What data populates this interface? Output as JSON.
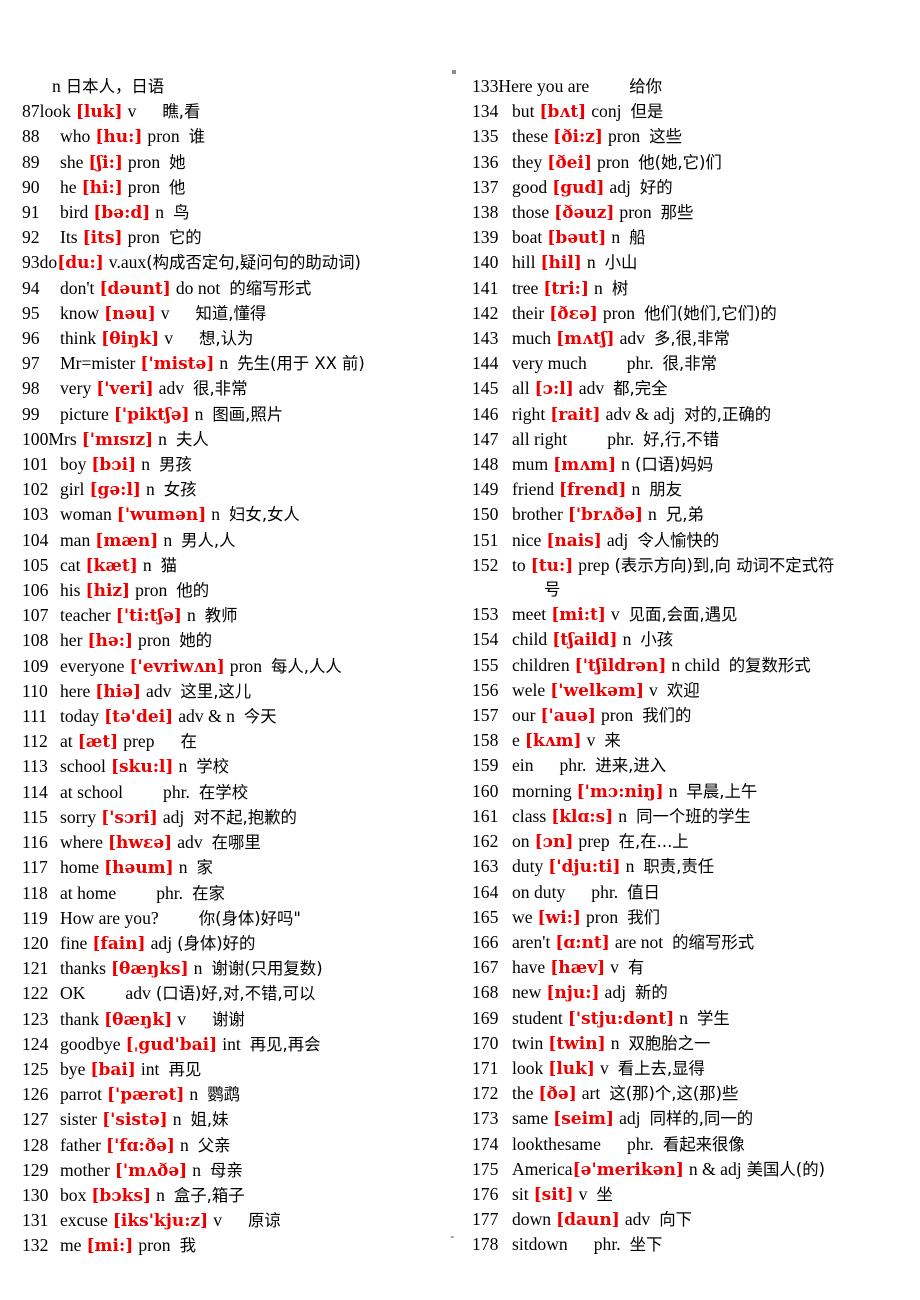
{
  "page": {
    "top_mark": "·",
    "bottom_mark": "-"
  },
  "header_line": {
    "pos": "n",
    "cn": "日本人，日语"
  },
  "left_column": [
    {
      "num": "87",
      "word": "look",
      "ipa": "[luk]",
      "pos": "v",
      "cn": "瞧,看",
      "gap": "sp4",
      "tight": true
    },
    {
      "num": "88",
      "word": "who",
      "ipa": "[hu:]",
      "pos": "pron",
      "cn": "谁",
      "gap": "sp2"
    },
    {
      "num": "89",
      "word": "she",
      "ipa": "[ʃi:]",
      "pos": "pron",
      "cn": "她",
      "gap": "sp2"
    },
    {
      "num": "90",
      "word": "he",
      "ipa": "[hi:]",
      "pos": "pron",
      "cn": "他",
      "gap": "sp2"
    },
    {
      "num": "91",
      "word": "bird",
      "ipa": "[bə:d]",
      "pos": "n",
      "cn": "鸟",
      "gap": "sp2"
    },
    {
      "num": "92",
      "word": "Its",
      "ipa": "[its]",
      "pos": "pron",
      "cn": "它的",
      "gap": "sp2"
    },
    {
      "num": "93",
      "word": "do",
      "ipa": "[du:]",
      "pos": "v.aux",
      "cn": "(构成否定句,疑问句的助动词)",
      "gap": "none",
      "tight": true,
      "nospace": true
    },
    {
      "num": "94",
      "word": "don't",
      "ipa": "[dəunt]",
      "pos": "do not",
      "cn": "的缩写形式",
      "gap": "sp2"
    },
    {
      "num": "95",
      "word": "know",
      "ipa": "[nəu]",
      "pos": "v",
      "cn": "知道,懂得",
      "gap": "sp4"
    },
    {
      "num": "96",
      "word": "think",
      "ipa": "[θiŋk]",
      "pos": "v",
      "cn": "想,认为",
      "gap": "sp4"
    },
    {
      "num": "97",
      "word": "Mr=mister",
      "ipa": "['mistə]",
      "pos": "n",
      "cn": "先生(用于 XX 前)",
      "gap": "sp2"
    },
    {
      "num": "98",
      "word": "very",
      "ipa": "['veri]",
      "pos": "adv",
      "cn": "很,非常",
      "gap": "sp2"
    },
    {
      "num": "99",
      "word": "picture",
      "ipa": "['piktʃə]",
      "pos": "n",
      "cn": "图画,照片",
      "gap": "sp2"
    },
    {
      "num": "100",
      "word": "Mrs",
      "ipa": "['mɪsɪz]",
      "pos": "n",
      "cn": "夫人",
      "gap": "sp2",
      "tight": true
    },
    {
      "num": "101",
      "word": "boy",
      "ipa": "[bɔi]",
      "pos": "n",
      "cn": "男孩",
      "gap": "sp2"
    },
    {
      "num": "102",
      "word": "girl",
      "ipa": "[gə:l]",
      "pos": "n",
      "cn": "女孩",
      "gap": "sp2"
    },
    {
      "num": "103",
      "word": "woman",
      "ipa": "['wumən]",
      "pos": "n",
      "cn": "妇女,女人",
      "gap": "sp2"
    },
    {
      "num": "104",
      "word": "man",
      "ipa": "[mæn]",
      "pos": "n",
      "cn": "男人,人",
      "gap": "sp2"
    },
    {
      "num": "105",
      "word": "cat",
      "ipa": "[kæt]",
      "pos": "n",
      "cn": "猫",
      "gap": "sp2"
    },
    {
      "num": "106",
      "word": "his",
      "ipa": "[hiz]",
      "pos": "pron",
      "cn": "他的",
      "gap": "sp2"
    },
    {
      "num": "107",
      "word": "teacher",
      "ipa": "['ti:tʃə]",
      "pos": "n",
      "cn": "教师",
      "gap": "sp2"
    },
    {
      "num": "108",
      "word": "her",
      "ipa": "[hə:]",
      "pos": "pron",
      "cn": "她的",
      "gap": "sp2"
    },
    {
      "num": "109",
      "word": "everyone",
      "ipa": "['evriwʌn]",
      "pos": "pron",
      "cn": "每人,人人",
      "gap": "sp2"
    },
    {
      "num": "110",
      "word": "here",
      "ipa": "[hiə]",
      "pos": "adv",
      "cn": "这里,这儿",
      "gap": "sp2"
    },
    {
      "num": "111",
      "word": "today",
      "ipa": "[tə'dei]",
      "pos": "adv & n",
      "cn": "今天",
      "gap": "sp2"
    },
    {
      "num": "112",
      "word": "at",
      "ipa": "[æt]",
      "pos": "prep",
      "cn": "在",
      "gap": "sp4"
    },
    {
      "num": "113",
      "word": "school",
      "ipa": "[sku:l]",
      "pos": "n",
      "cn": "学校",
      "gap": "sp2"
    },
    {
      "num": "114",
      "word": "at school",
      "ipa": "",
      "pos": "phr.",
      "cn": "在学校",
      "gap": "sp2",
      "posgap": "sp5"
    },
    {
      "num": "115",
      "word": "sorry",
      "ipa": "['sɔri]",
      "pos": "adj",
      "cn": "对不起,抱歉的",
      "gap": "sp2"
    },
    {
      "num": "116",
      "word": "where",
      "ipa": "[hwɛə]",
      "pos": "adv",
      "cn": "在哪里",
      "gap": "sp2"
    },
    {
      "num": "117",
      "word": "home",
      "ipa": "[həum]",
      "pos": "n",
      "cn": "家",
      "gap": "sp2"
    },
    {
      "num": "118",
      "word": "at home",
      "ipa": "",
      "pos": "phr.",
      "cn": "在家",
      "gap": "sp2",
      "posgap": "sp5"
    },
    {
      "num": "119",
      "word": "How are you?",
      "ipa": "",
      "pos": "",
      "cn": "你(身体)好吗\"",
      "gap": "sp5",
      "posgap": "sp5"
    },
    {
      "num": "120",
      "word": "fine",
      "ipa": "[fain]",
      "pos": "adj",
      "cn": "(身体)好的",
      "gap": "sp1"
    },
    {
      "num": "121",
      "word": "thanks",
      "ipa": "[θæŋks]",
      "pos": "n",
      "cn": "谢谢(只用复数)",
      "gap": "sp2"
    },
    {
      "num": "122",
      "word": "OK",
      "ipa": "",
      "pos": "adv",
      "cn": "(口语)好,对,不错,可以",
      "gap": "sp1",
      "posgap": "sp5"
    },
    {
      "num": "123",
      "word": "thank",
      "ipa": "[θæŋk]",
      "pos": "v",
      "cn": "谢谢",
      "gap": "sp4"
    },
    {
      "num": "124",
      "word": "goodbye",
      "ipa": "[ˌgud'bai]",
      "pos": "int",
      "cn": "再见,再会",
      "gap": "sp2"
    },
    {
      "num": "125",
      "word": "bye",
      "ipa": "[bai]",
      "pos": "int",
      "cn": "再见",
      "gap": "sp2"
    },
    {
      "num": "126",
      "word": "parrot",
      "ipa": "['pærət]",
      "pos": "n",
      "cn": "鹦鹉",
      "gap": "sp2"
    },
    {
      "num": "127",
      "word": "sister",
      "ipa": "['sistə]",
      "pos": "n",
      "cn": "姐,妹",
      "gap": "sp2"
    },
    {
      "num": "128",
      "word": "father",
      "ipa": "['fɑ:ðə]",
      "pos": "n",
      "cn": "父亲",
      "gap": "sp2"
    },
    {
      "num": "129",
      "word": "mother",
      "ipa": "['mʌðə]",
      "pos": "n",
      "cn": "母亲",
      "gap": "sp2"
    },
    {
      "num": "130",
      "word": "box",
      "ipa": "[bɔks]",
      "pos": "n",
      "cn": "盒子,箱子",
      "gap": "sp2"
    },
    {
      "num": "131",
      "word": "excuse",
      "ipa": "[iks'kju:z]",
      "pos": "v",
      "cn": "原谅",
      "gap": "sp4"
    },
    {
      "num": "132",
      "word": "me",
      "ipa": "[mi:]",
      "pos": "pron",
      "cn": "我",
      "gap": "sp2"
    }
  ],
  "right_column": [
    {
      "num": "133",
      "word": "Here you are",
      "ipa": "",
      "pos": "",
      "cn": "给你",
      "gap": "sp5",
      "tight": true
    },
    {
      "num": "134",
      "word": "but",
      "ipa": "[bʌt]",
      "pos": "conj",
      "cn": "但是",
      "gap": "sp2"
    },
    {
      "num": "135",
      "word": "these",
      "ipa": "[ði:z]",
      "pos": "pron",
      "cn": "这些",
      "gap": "sp2"
    },
    {
      "num": "136",
      "word": "they",
      "ipa": "[ðei]",
      "pos": "pron",
      "cn": "他(她,它)们",
      "gap": "sp2"
    },
    {
      "num": "137",
      "word": "good",
      "ipa": "[gud]",
      "pos": "adj",
      "cn": "好的",
      "gap": "sp2"
    },
    {
      "num": "138",
      "word": "those",
      "ipa": "[ðəuz]",
      "pos": "pron",
      "cn": "那些",
      "gap": "sp2"
    },
    {
      "num": "139",
      "word": "boat",
      "ipa": "[bəut]",
      "pos": "n",
      "cn": "船",
      "gap": "sp2"
    },
    {
      "num": "140",
      "word": "hill",
      "ipa": "[hil]",
      "pos": "n",
      "cn": "小山",
      "gap": "sp2"
    },
    {
      "num": "141",
      "word": "tree",
      "ipa": "[tri:]",
      "pos": "n",
      "cn": "树",
      "gap": "sp2"
    },
    {
      "num": "142",
      "word": "their",
      "ipa": "[ðɛə]",
      "pos": "pron",
      "cn": "他们(她们,它们)的",
      "gap": "sp2"
    },
    {
      "num": "143",
      "word": "much",
      "ipa": "[mʌtʃ]",
      "pos": "adv",
      "cn": "多,很,非常",
      "gap": "sp2"
    },
    {
      "num": "144",
      "word": "very much",
      "ipa": "",
      "pos": "phr.",
      "cn": "很,非常",
      "gap": "sp2",
      "posgap": "sp5"
    },
    {
      "num": "145",
      "word": "all",
      "ipa": "[ɔ:l]",
      "pos": "adv",
      "cn": "都,完全",
      "gap": "sp2"
    },
    {
      "num": "146",
      "word": "right",
      "ipa": "[rait]",
      "pos": "adv & adj",
      "cn": "对的,正确的",
      "gap": "sp2"
    },
    {
      "num": "147",
      "word": "all right",
      "ipa": "",
      "pos": "phr.",
      "cn": "好,行,不错",
      "gap": "sp2",
      "posgap": "sp5"
    },
    {
      "num": "148",
      "word": "mum",
      "ipa": "[mʌm]",
      "pos": "n",
      "cn": "(口语)妈妈",
      "gap": "sp1"
    },
    {
      "num": "149",
      "word": "friend",
      "ipa": "[frend]",
      "pos": "n",
      "cn": "朋友",
      "gap": "sp2"
    },
    {
      "num": "150",
      "word": "brother",
      "ipa": "['brʌðə]",
      "pos": "n",
      "cn": "兄,弟",
      "gap": "sp2"
    },
    {
      "num": "151",
      "word": "nice",
      "ipa": "[nais]",
      "pos": "adj",
      "cn": "令人愉快的",
      "gap": "sp2"
    },
    {
      "num": "152",
      "word": "to",
      "ipa": "[tu:]",
      "pos": "prep",
      "cn": "(表示方向)到,向  动词不定式符",
      "gap": "sp1",
      "cont": "号"
    },
    {
      "num": "153",
      "word": "meet",
      "ipa": "[mi:t]",
      "pos": "v",
      "cn": "见面,会面,遇见",
      "gap": "sp2"
    },
    {
      "num": "154",
      "word": "child",
      "ipa": "[tʃaild]",
      "pos": "n",
      "cn": "小孩",
      "gap": "sp2"
    },
    {
      "num": "155",
      "word": "children",
      "ipa": "['tʃildrən]",
      "pos": "n child",
      "cn": "的复数形式",
      "gap": "sp2"
    },
    {
      "num": "156",
      "word": "wele",
      "ipa": "['welkəm]",
      "pos": "v",
      "cn": "欢迎",
      "gap": "sp2"
    },
    {
      "num": "157",
      "word": "our",
      "ipa": "['auə]",
      "pos": "pron",
      "cn": "我们的",
      "gap": "sp2"
    },
    {
      "num": "158",
      "word": "e",
      "ipa": "[kʌm]",
      "pos": "v",
      "cn": "来",
      "gap": "sp2"
    },
    {
      "num": "159",
      "word": "ein",
      "ipa": "",
      "pos": "phr.",
      "cn": "进来,进入",
      "gap": "sp2",
      "posgap": "sp4"
    },
    {
      "num": "160",
      "word": "morning",
      "ipa": "['mɔ:niŋ]",
      "pos": "n",
      "cn": "早晨,上午",
      "gap": "sp2"
    },
    {
      "num": "161",
      "word": "class",
      "ipa": "[klɑ:s]",
      "pos": "n",
      "cn": "同一个班的学生",
      "gap": "sp2"
    },
    {
      "num": "162",
      "word": "on",
      "ipa": "[ɔn]",
      "pos": "prep",
      "cn": "在,在...上",
      "gap": "sp2"
    },
    {
      "num": "163",
      "word": "duty",
      "ipa": "['dju:ti]",
      "pos": "n",
      "cn": "职责,责任",
      "gap": "sp2"
    },
    {
      "num": "164",
      "word": "on duty",
      "ipa": "",
      "pos": "phr.",
      "cn": "值日",
      "gap": "sp2",
      "posgap": "sp4"
    },
    {
      "num": "165",
      "word": "we",
      "ipa": "[wi:]",
      "pos": "pron",
      "cn": "我们",
      "gap": "sp2"
    },
    {
      "num": "166",
      "word": "aren't",
      "ipa": "[ɑ:nt]",
      "pos": "are not",
      "cn": "的缩写形式",
      "gap": "sp2"
    },
    {
      "num": "167",
      "word": "have",
      "ipa": "[hæv]",
      "pos": "v",
      "cn": "有",
      "gap": "sp2"
    },
    {
      "num": "168",
      "word": "new",
      "ipa": "[nju:]",
      "pos": "adj",
      "cn": "新的",
      "gap": "sp2"
    },
    {
      "num": "169",
      "word": "student",
      "ipa": "['stju:dənt]",
      "pos": "n",
      "cn": "学生",
      "gap": "sp2"
    },
    {
      "num": "170",
      "word": "twin",
      "ipa": "[twin]",
      "pos": "n",
      "cn": "双胞胎之一",
      "gap": "sp2"
    },
    {
      "num": "171",
      "word": "look",
      "ipa": "[luk]",
      "pos": "v",
      "cn": "看上去,显得",
      "gap": "sp2"
    },
    {
      "num": "172",
      "word": "the",
      "ipa": "[ðə]",
      "pos": "art",
      "cn": "这(那)个,这(那)些",
      "gap": "sp2"
    },
    {
      "num": "173",
      "word": "same",
      "ipa": "[seim]",
      "pos": "adj",
      "cn": "同样的,同一的",
      "gap": "sp2"
    },
    {
      "num": "174",
      "word": "lookthesame",
      "ipa": "",
      "pos": "phr.",
      "cn": "看起来很像",
      "gap": "sp2",
      "posgap": "sp4"
    },
    {
      "num": "175",
      "word": "America",
      "ipa": "[ə'merikən]",
      "pos": "n & adj",
      "cn": "美国人(的)",
      "gap": "sp1",
      "nospace": true
    },
    {
      "num": "176",
      "word": "sit",
      "ipa": "[sit]",
      "pos": "v",
      "cn": "坐",
      "gap": "sp2"
    },
    {
      "num": "177",
      "word": "down",
      "ipa": "[daun]",
      "pos": "adv",
      "cn": "向下",
      "gap": "sp2"
    },
    {
      "num": "178",
      "word": "sitdown",
      "ipa": "",
      "pos": "phr.",
      "cn": "坐下",
      "gap": "sp2",
      "posgap": "sp4"
    }
  ]
}
